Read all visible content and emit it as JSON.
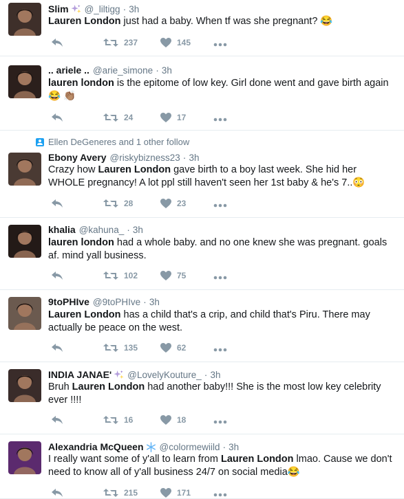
{
  "tweets": [
    {
      "context": "",
      "name": "Slim",
      "name_emoji": "sparkles",
      "handle": "@_liltigg",
      "time": "3h",
      "text_parts": [
        {
          "t": "Lauren London",
          "b": true
        },
        {
          "t": " just had a baby. When tf was she pregnant? 😂",
          "b": false
        }
      ],
      "retweets": "237",
      "likes": "145",
      "avatar_color": "#3e2f2a"
    },
    {
      "context": "",
      "name": ".. ariele ..",
      "name_emoji": "",
      "handle": "@arie_simone",
      "time": "3h",
      "text_parts": [
        {
          "t": "lauren london",
          "b": true
        },
        {
          "t": " is the epitome of low key. Girl done went and gave birth again 😂 👏🏽",
          "b": false
        }
      ],
      "retweets": "24",
      "likes": "17",
      "avatar_color": "#2b1f1c"
    },
    {
      "context": "Ellen DeGeneres and 1 other follow",
      "name": "Ebony Avery",
      "name_emoji": "",
      "handle": "@riskybizness23",
      "time": "3h",
      "text_parts": [
        {
          "t": "Crazy how ",
          "b": false
        },
        {
          "t": "Lauren London",
          "b": true
        },
        {
          "t": " gave birth to a boy last week. She hid her WHOLE pregnancy! A lot ppl still haven't seen her 1st baby & he's 7..😳",
          "b": false
        }
      ],
      "retweets": "28",
      "likes": "23",
      "avatar_color": "#4a3a33"
    },
    {
      "context": "",
      "name": "khalia",
      "name_emoji": "",
      "handle": "@kahuna_",
      "time": "3h",
      "text_parts": [
        {
          "t": "lauren london",
          "b": true
        },
        {
          "t": " had a whole baby. and no one knew she was pregnant. goals af. mind yall business.",
          "b": false
        }
      ],
      "retweets": "102",
      "likes": "75",
      "avatar_color": "#231a17"
    },
    {
      "context": "",
      "name": "9toPHIve",
      "name_emoji": "",
      "handle": "@9toPHIve",
      "time": "3h",
      "text_parts": [
        {
          "t": "Lauren London",
          "b": true
        },
        {
          "t": " has a child that's a crip, and child that's Piru. There may actually be peace on the west.",
          "b": false
        }
      ],
      "retweets": "135",
      "likes": "62",
      "avatar_color": "#6b5a4f"
    },
    {
      "context": "",
      "name": "INDIA JANAE'",
      "name_emoji": "sparkles",
      "handle": "@LovelyKouture_",
      "time": "3h",
      "text_parts": [
        {
          "t": "Bruh ",
          "b": false
        },
        {
          "t": "Lauren London",
          "b": true
        },
        {
          "t": " had another baby!!! She is the most low key celebrity ever !!!!",
          "b": false
        }
      ],
      "retweets": "16",
      "likes": "18",
      "avatar_color": "#3a2c2a"
    },
    {
      "context": "",
      "name": "Alexandria McQueen",
      "name_emoji": "snowflake",
      "handle": "@colormewiild",
      "time": "3h",
      "text_parts": [
        {
          "t": "I really want some of y'all to learn from ",
          "b": false
        },
        {
          "t": "Lauren London",
          "b": true
        },
        {
          "t": " lmao. Cause we don't need to know all of y'all business 24/7 on social media😂",
          "b": false
        }
      ],
      "retweets": "215",
      "likes": "171",
      "avatar_color": "#5b2a6e"
    }
  ],
  "colors": {
    "text": "#14171a",
    "muted": "#657786",
    "icon": "#8899a6",
    "divider": "#e6ecf0",
    "accent": "#1da1f2"
  },
  "icons": {
    "reply": "reply-icon",
    "retweet": "retweet-icon",
    "like": "heart-icon",
    "more": "more-icon"
  }
}
